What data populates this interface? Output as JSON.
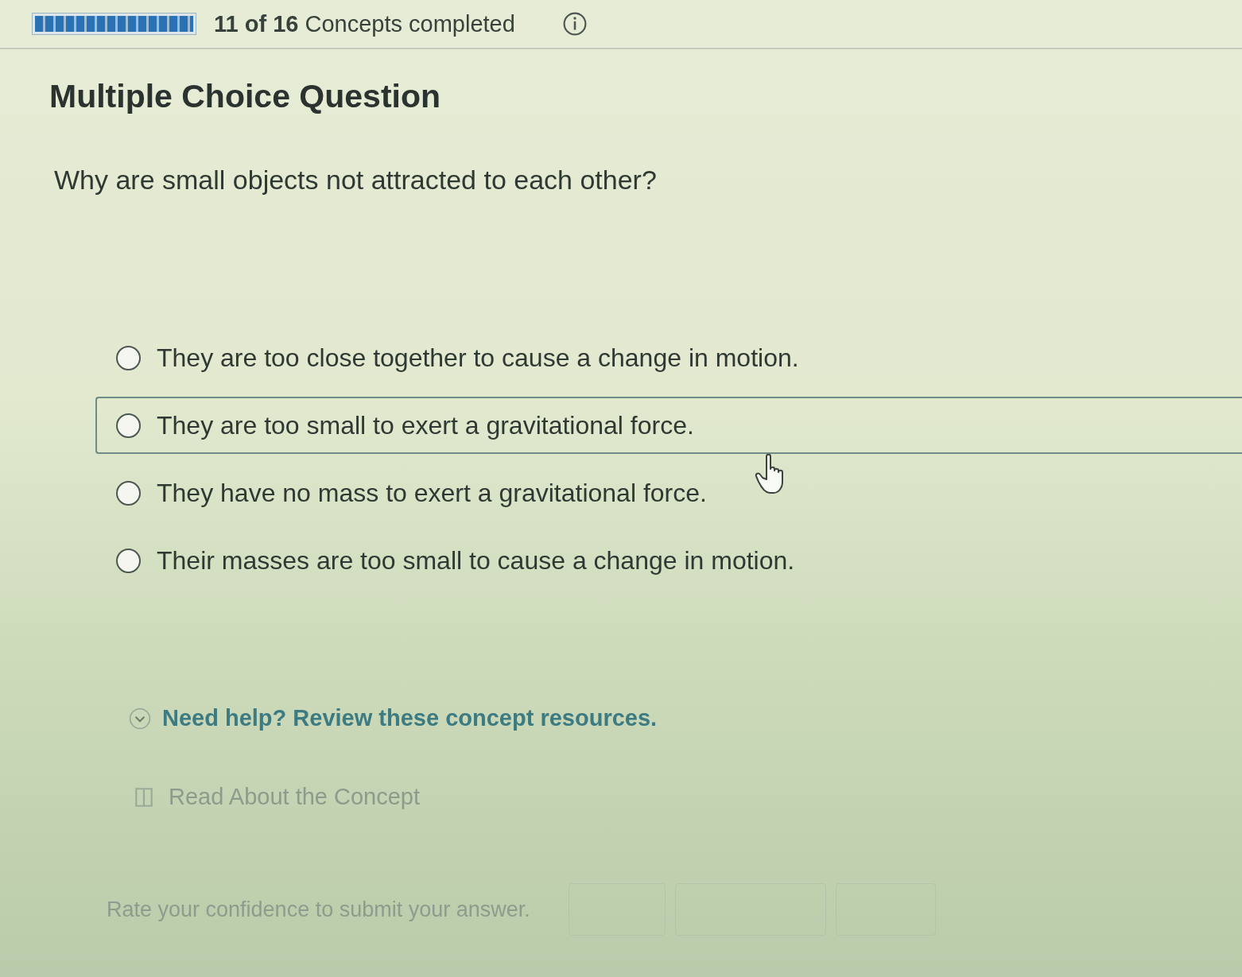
{
  "progress": {
    "level": 1,
    "label": "**11 of 16** Concepts completed"
  },
  "title": "Multiple Choice Question",
  "question": "Why are small objects not attracted to each other?",
  "options": [
    {
      "label": "They are too close together to cause a change in motion.",
      "selected": false,
      "hovered": false
    },
    {
      "label": "They are too small to exert a gravitational force.",
      "selected": false,
      "hovered": true
    },
    {
      "label": "They have no mass to exert a gravitational force.",
      "selected": false,
      "hovered": false
    },
    {
      "label": "Their masses are too small to cause a change in motion.",
      "selected": false,
      "hovered": false
    }
  ],
  "help": {
    "label": "Need help? Review these concept resources."
  },
  "resources": [
    {
      "label": "Read About the Concept"
    }
  ],
  "confidence": {
    "prompt": "Rate your confidence to submit your answer.",
    "options": [
      {
        "selected": false
      },
      {
        "selected": false
      },
      {
        "selected": false
      }
    ]
  }
}
